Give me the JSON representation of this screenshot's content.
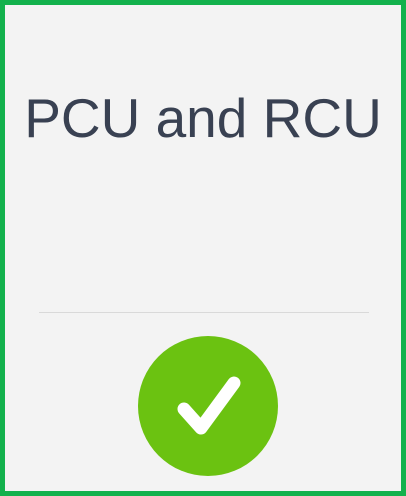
{
  "card": {
    "title": "PCU and RCU",
    "status_icon": "check-icon",
    "status": "complete"
  },
  "colors": {
    "border": "#12b14c",
    "background": "#f3f3f3",
    "title_text": "#394152",
    "check_circle": "#6bc211",
    "check_mark": "#ffffff"
  }
}
